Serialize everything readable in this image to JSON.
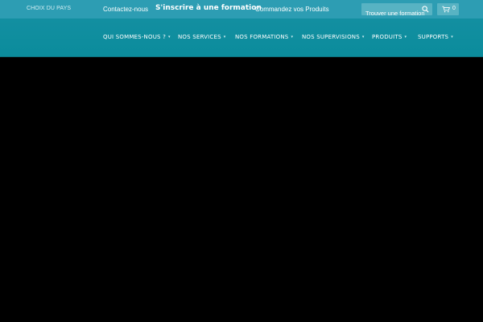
{
  "topbar": {
    "country_label": "CHOIX DU PAYS",
    "contact_label": "Contactez-nous",
    "signup_label": "S'inscrire à une formation",
    "order_label": "Commandez vos Produits",
    "search_placeholder": "Trouver une formation",
    "cart_count": "0"
  },
  "nav": {
    "items": [
      {
        "label": "QUI SOMMES-NOUS ?"
      },
      {
        "label": "NOS SERVICES"
      },
      {
        "label": "NOS FORMATIONS"
      },
      {
        "label": "NOS SUPERVISIONS"
      },
      {
        "label": "PRODUITS"
      },
      {
        "label": "SUPPORTS"
      }
    ]
  },
  "colors": {
    "topbar_bg": "#2d9db3",
    "nav_bg": "#0b8c9c",
    "content_bg": "#000000"
  }
}
